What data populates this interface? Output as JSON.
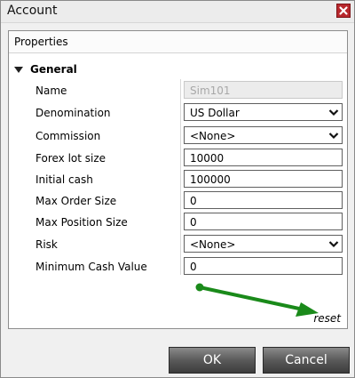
{
  "window": {
    "title": "Account"
  },
  "panel": {
    "header": "Properties",
    "group_label": "General"
  },
  "properties": [
    {
      "label": "Name",
      "value": "Sim101",
      "kind": "disabled"
    },
    {
      "label": "Denomination",
      "value": "US Dollar",
      "kind": "select"
    },
    {
      "label": "Commission",
      "value": "<None>",
      "kind": "select"
    },
    {
      "label": "Forex lot size",
      "value": "10000",
      "kind": "text"
    },
    {
      "label": "Initial cash",
      "value": "100000",
      "kind": "text"
    },
    {
      "label": "Max Order Size",
      "value": "0",
      "kind": "text"
    },
    {
      "label": "Max Position Size",
      "value": "0",
      "kind": "text"
    },
    {
      "label": "Risk",
      "value": "<None>",
      "kind": "select"
    },
    {
      "label": "Minimum Cash Value",
      "value": "0",
      "kind": "text"
    }
  ],
  "reset_label": "reset",
  "buttons": {
    "ok": "OK",
    "cancel": "Cancel"
  },
  "colors": {
    "close_button": "#b8282d",
    "annotation_arrow": "#1a8a1a",
    "button_face": "#5a5a5a"
  },
  "icons": {
    "close": "close-icon",
    "expand": "triangle-down-icon",
    "dropdown": "chevron-down-icon",
    "annotation": "green-arrow-icon"
  }
}
